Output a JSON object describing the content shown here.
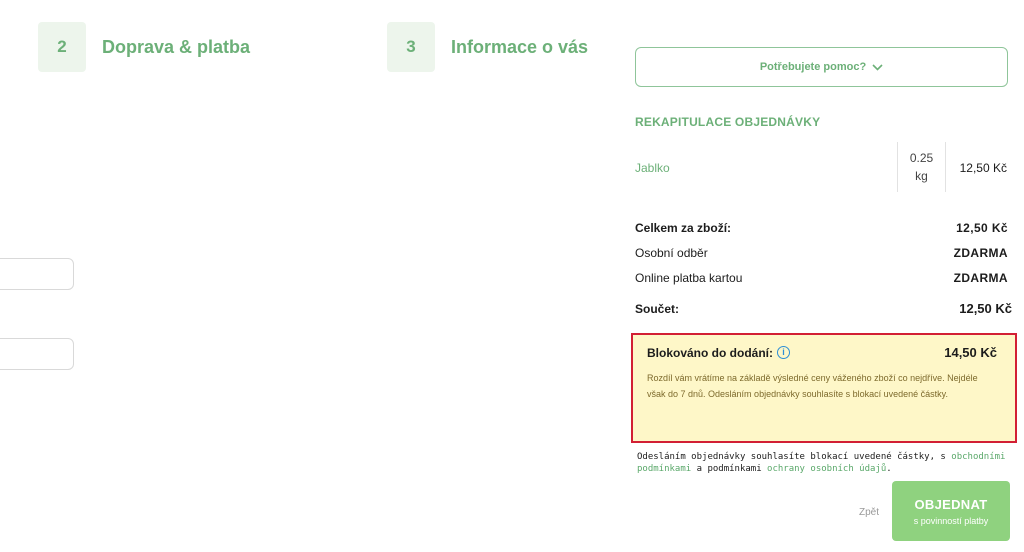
{
  "steps": [
    {
      "number": "2",
      "label": "Doprava & platba"
    },
    {
      "number": "3",
      "label": "Informace o vás"
    }
  ],
  "help": {
    "label": "Potřebujete pomoc?",
    "icon": "chevron-down-icon"
  },
  "recap": {
    "title": "REKAPITULACE OBJEDNÁVKY",
    "items": [
      {
        "name": "Jablko",
        "qty_value": "0.25",
        "qty_unit": "kg",
        "price": "12,50 Kč"
      }
    ],
    "goods_total_label": "Celkem za zboží:",
    "goods_total_value": "12,50 Kč",
    "shipping_label": "Osobní odběr",
    "shipping_value": "ZDARMA",
    "payment_label": "Online platba kartou",
    "payment_value": "ZDARMA",
    "sum_label": "Součet:",
    "sum_value": "12,50 Kč"
  },
  "blocked": {
    "title": "Blokováno do dodání:",
    "amount": "14,50 Kč",
    "text": "Rozdíl vám vrátíme na základě výsledné ceny váženého zboží co nejdříve. Nejdéle však do 7 dnů. Odesláním objednávky souhlasíte s blokací uvedené částky.",
    "border_color": "#d21f34",
    "background": "#fef7c8"
  },
  "terms": {
    "prefix": "Odesláním objednávky souhlasíte blokací uvedené částky, s ",
    "link1": "obchodními podmínkami",
    "middle": " a podmínkami ",
    "link2": "ochrany osobních údajů",
    "suffix": "."
  },
  "actions": {
    "back": "Zpět",
    "order": "OBJEDNAT",
    "order_sub": "s povinností platby"
  },
  "colors": {
    "accent": "#6cb078",
    "button": "#8fd27f"
  }
}
